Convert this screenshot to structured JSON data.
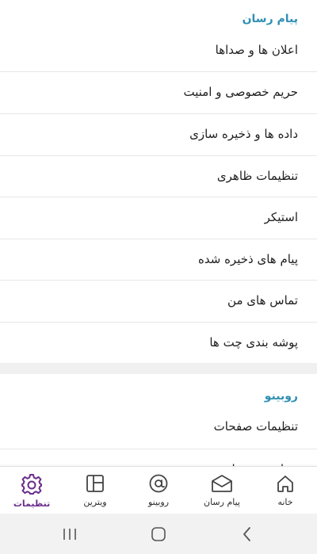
{
  "sections": {
    "messenger": {
      "title": "پیام رسان",
      "items": [
        {
          "label": "اعلان ها و صداها"
        },
        {
          "label": "حریم خصوصی و امنیت"
        },
        {
          "label": "داده ها و ذخیره سازی"
        },
        {
          "label": "تنظیمات ظاهری"
        },
        {
          "label": "استیکر"
        },
        {
          "label": "پیام های ذخیره شده"
        },
        {
          "label": "تماس های من"
        },
        {
          "label": "پوشه بندی چت ها"
        }
      ]
    },
    "rubino": {
      "title": "روبینو",
      "items": [
        {
          "label": "تنظیمات صفحات"
        },
        {
          "label": "نشان شده ها"
        }
      ]
    }
  },
  "tabbar": {
    "tabs": [
      {
        "label": "خانه",
        "icon": "home-icon"
      },
      {
        "label": "پیام رسان",
        "icon": "envelope-icon"
      },
      {
        "label": "روبینو",
        "icon": "at-icon"
      },
      {
        "label": "ویترین",
        "icon": "grid-icon"
      },
      {
        "label": "تنظیمات",
        "icon": "gear-icon"
      }
    ],
    "active_tab": "تنظیمات"
  },
  "colors": {
    "section_header": "#2f8fb3",
    "active_tab": "#6a2c8c"
  }
}
